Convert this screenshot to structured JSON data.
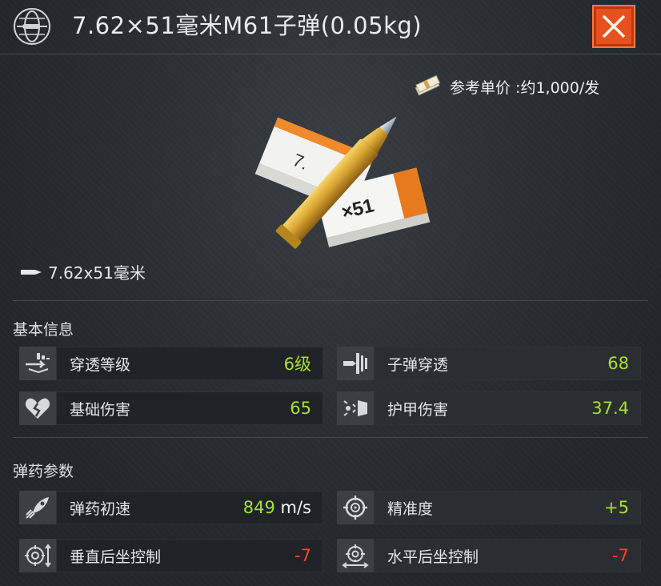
{
  "header": {
    "title": "7.62×51毫米M61子弹(0.05kg)"
  },
  "preview": {
    "price_label": "参考单价 :约1,000/发",
    "box_label": "×51",
    "caliber": "7.62x51毫米"
  },
  "basic_info": {
    "title": "基本信息",
    "stats": [
      {
        "label": "穿透等级",
        "value": "6级",
        "icon": "penetration-level-icon"
      },
      {
        "label": "子弹穿透",
        "value": "68",
        "icon": "bullet-penetration-icon"
      },
      {
        "label": "基础伤害",
        "value": "65",
        "icon": "broken-heart-icon"
      },
      {
        "label": "护甲伤害",
        "value": "37.4",
        "icon": "armor-damage-icon"
      }
    ]
  },
  "ammo_params": {
    "title": "弹药参数",
    "stats": [
      {
        "label": "弹药初速",
        "value": "849",
        "unit": "m/s",
        "icon": "rocket-icon"
      },
      {
        "label": "精准度",
        "value": "+5",
        "icon": "crosshair-icon"
      },
      {
        "label": "垂直后坐控制",
        "value": "-7",
        "icon": "vertical-recoil-icon"
      },
      {
        "label": "水平后坐控制",
        "value": "-7",
        "icon": "horizontal-recoil-icon"
      }
    ]
  },
  "colors": {
    "positive": "#a6e22a",
    "negative": "#f2461e",
    "close_button": "#e8501e"
  }
}
